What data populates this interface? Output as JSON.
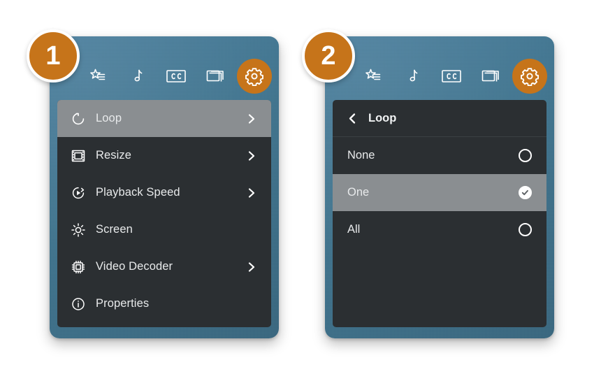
{
  "meta": {
    "colors": {
      "accent_orange": "#c6741a",
      "card_blue": "#41758f",
      "menu_dark": "#2b2f32",
      "row_highlight": "#8a8e91",
      "text_light": "#e8eaeb"
    }
  },
  "steps": [
    {
      "number": "1"
    },
    {
      "number": "2"
    }
  ],
  "toolbar": {
    "buttons": [
      {
        "icon": "playlist-star-icon",
        "label": "Playlist"
      },
      {
        "icon": "music-note-icon",
        "label": "Audio Track"
      },
      {
        "icon": "closed-captions-icon",
        "label": "CC"
      },
      {
        "icon": "video-window-icon",
        "label": "Video"
      },
      {
        "icon": "gear-icon",
        "label": "Settings"
      }
    ]
  },
  "panel_1": {
    "items": [
      {
        "label": "Loop",
        "icon": "loop-icon",
        "has_chevron": true,
        "selected": true
      },
      {
        "label": "Resize",
        "icon": "resize-icon",
        "has_chevron": true,
        "selected": false
      },
      {
        "label": "Playback Speed",
        "icon": "playback-speed-icon",
        "has_chevron": true,
        "selected": false
      },
      {
        "label": "Screen",
        "icon": "brightness-icon",
        "has_chevron": false,
        "selected": false
      },
      {
        "label": "Video Decoder",
        "icon": "chip-icon",
        "has_chevron": true,
        "selected": false
      },
      {
        "label": "Properties",
        "icon": "info-icon",
        "has_chevron": false,
        "selected": false
      }
    ]
  },
  "panel_2": {
    "header": {
      "title": "Loop",
      "back_icon": "chevron-left-icon"
    },
    "options": [
      {
        "label": "None",
        "selected": false
      },
      {
        "label": "One",
        "selected": true
      },
      {
        "label": "All",
        "selected": false
      }
    ]
  }
}
